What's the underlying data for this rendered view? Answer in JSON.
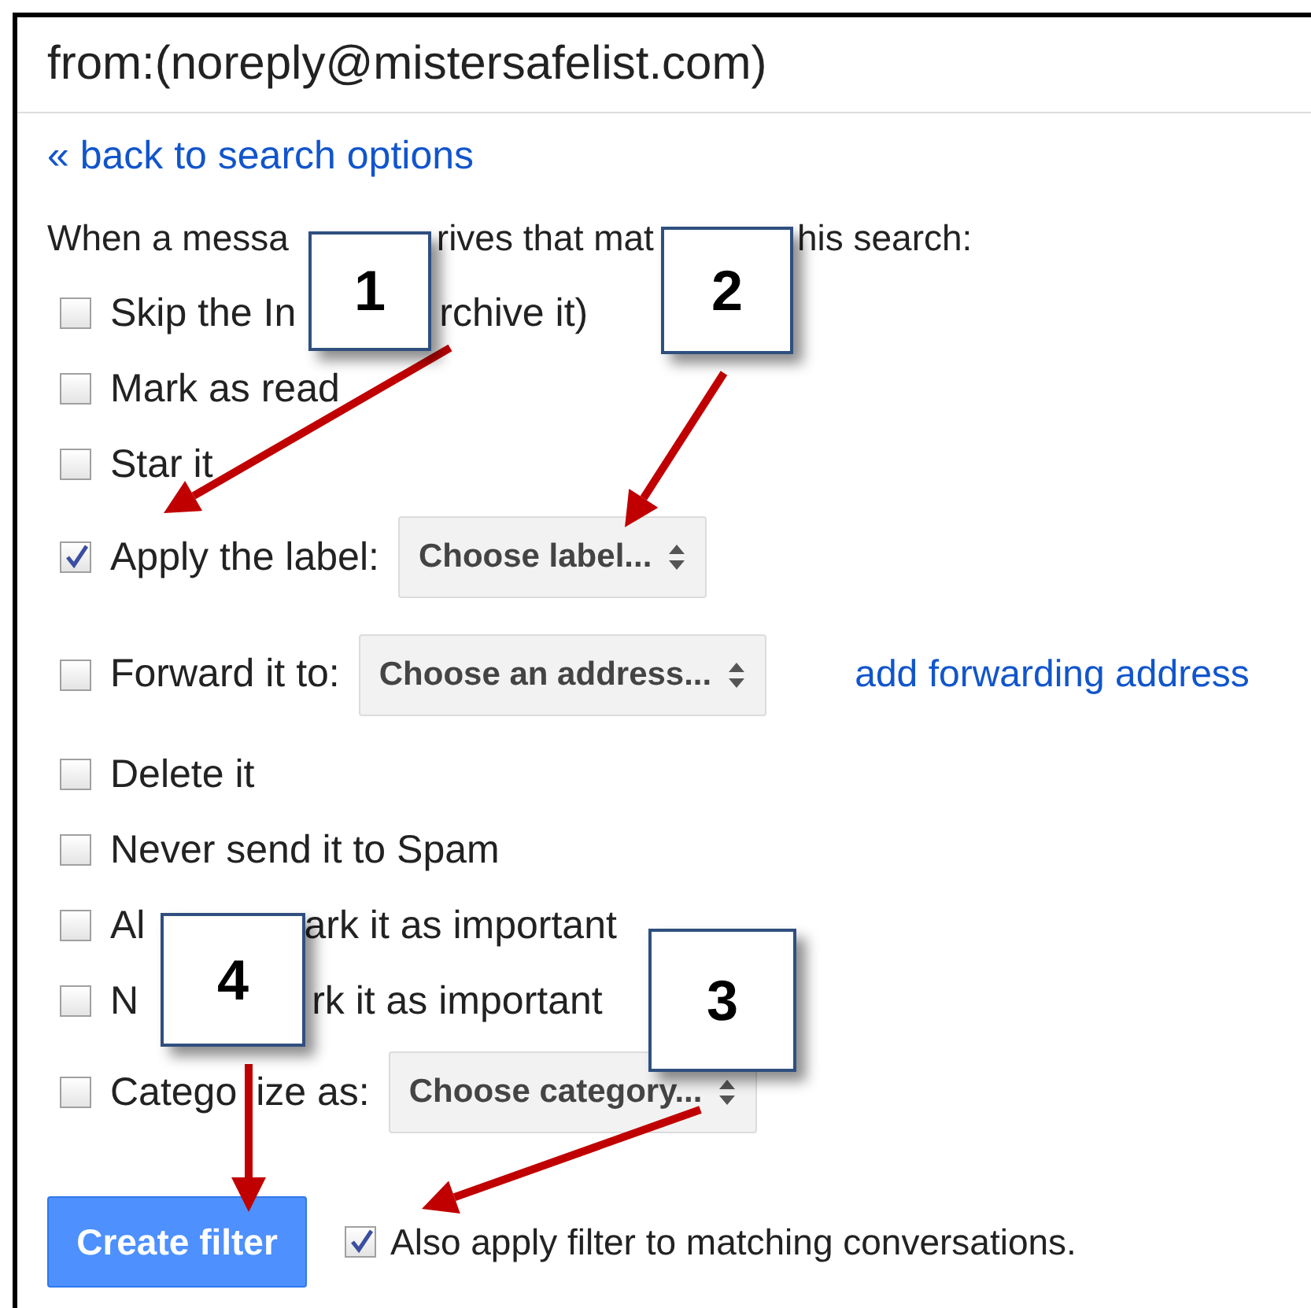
{
  "search_query": "from:(noreply@mistersafelist.com)",
  "back_link": "« back to search options",
  "intro_parts": [
    "When a messa",
    "rives that mat",
    "his search:"
  ],
  "actions": [
    {
      "kind": "plain",
      "parts": [
        "Skip the In",
        "rchive it)"
      ],
      "checked": false
    },
    {
      "kind": "plain",
      "parts": [
        "Mark as read"
      ],
      "checked": false
    },
    {
      "kind": "plain",
      "parts": [
        "Star it"
      ],
      "checked": false
    },
    {
      "kind": "select",
      "parts": [
        "Apply the label:"
      ],
      "checked": true,
      "select": "Choose label..."
    },
    {
      "kind": "select",
      "parts": [
        "Forward it to:"
      ],
      "checked": false,
      "select": "Choose an address...",
      "link": "add forwarding address"
    },
    {
      "kind": "plain",
      "parts": [
        "Delete it"
      ],
      "checked": false
    },
    {
      "kind": "plain",
      "parts": [
        "Never send it to Spam"
      ],
      "checked": false
    },
    {
      "kind": "plain",
      "parts": [
        "Al",
        "ark it as important"
      ],
      "checked": false
    },
    {
      "kind": "plain",
      "parts": [
        "N",
        "rk it as important"
      ],
      "checked": false
    },
    {
      "kind": "select",
      "parts": [
        "Catego",
        "ize as:"
      ],
      "checked": false,
      "select": "Choose category..."
    }
  ],
  "create_button": "Create filter",
  "also_apply": {
    "label": "Also apply filter to matching conversations.",
    "checked": true
  },
  "callouts": [
    {
      "number": "1"
    },
    {
      "number": "2"
    },
    {
      "number": "4"
    },
    {
      "number": "3"
    }
  ]
}
